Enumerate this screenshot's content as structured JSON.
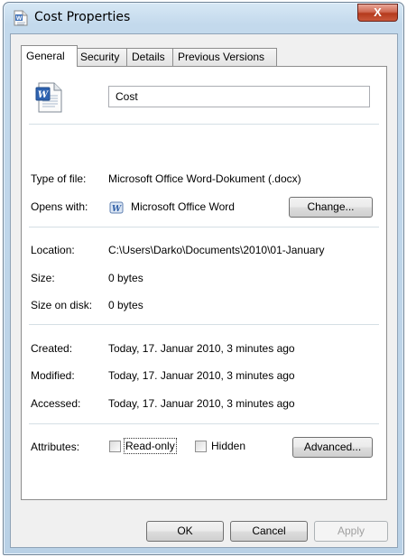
{
  "window": {
    "title": "Cost Properties",
    "close_label": "X"
  },
  "tabs": [
    {
      "label": "General",
      "active": true
    },
    {
      "label": "Security",
      "active": false
    },
    {
      "label": "Details",
      "active": false
    },
    {
      "label": "Previous Versions",
      "active": false
    }
  ],
  "general": {
    "file_name": "Cost",
    "type_label": "Type of file:",
    "type_value": "Microsoft Office Word-Dokument (.docx)",
    "opens_label": "Opens with:",
    "opens_value": "Microsoft Office Word",
    "change_button": "Change...",
    "location_label": "Location:",
    "location_value": "C:\\Users\\Darko\\Documents\\2010\\01-January",
    "size_label": "Size:",
    "size_value": "0 bytes",
    "size_on_disk_label": "Size on disk:",
    "size_on_disk_value": "0 bytes",
    "created_label": "Created:",
    "created_value": "Today, 17. Januar 2010, 3 minutes ago",
    "modified_label": "Modified:",
    "modified_value": "Today, 17. Januar 2010, 3 minutes ago",
    "accessed_label": "Accessed:",
    "accessed_value": "Today, 17. Januar 2010, 3 minutes ago",
    "attributes_label": "Attributes:",
    "readonly_label": "Read-only",
    "readonly_checked": false,
    "hidden_label": "Hidden",
    "hidden_checked": false,
    "advanced_button": "Advanced..."
  },
  "footer": {
    "ok": "OK",
    "cancel": "Cancel",
    "apply": "Apply"
  },
  "icons": {
    "title": "word-document-icon",
    "file": "word-document-icon",
    "app": "word-app-icon"
  },
  "colors": {
    "titlebar": "#b9d1e6",
    "close_button": "#c9583b",
    "panel": "#ffffff",
    "dialog": "#f0f0f0"
  }
}
